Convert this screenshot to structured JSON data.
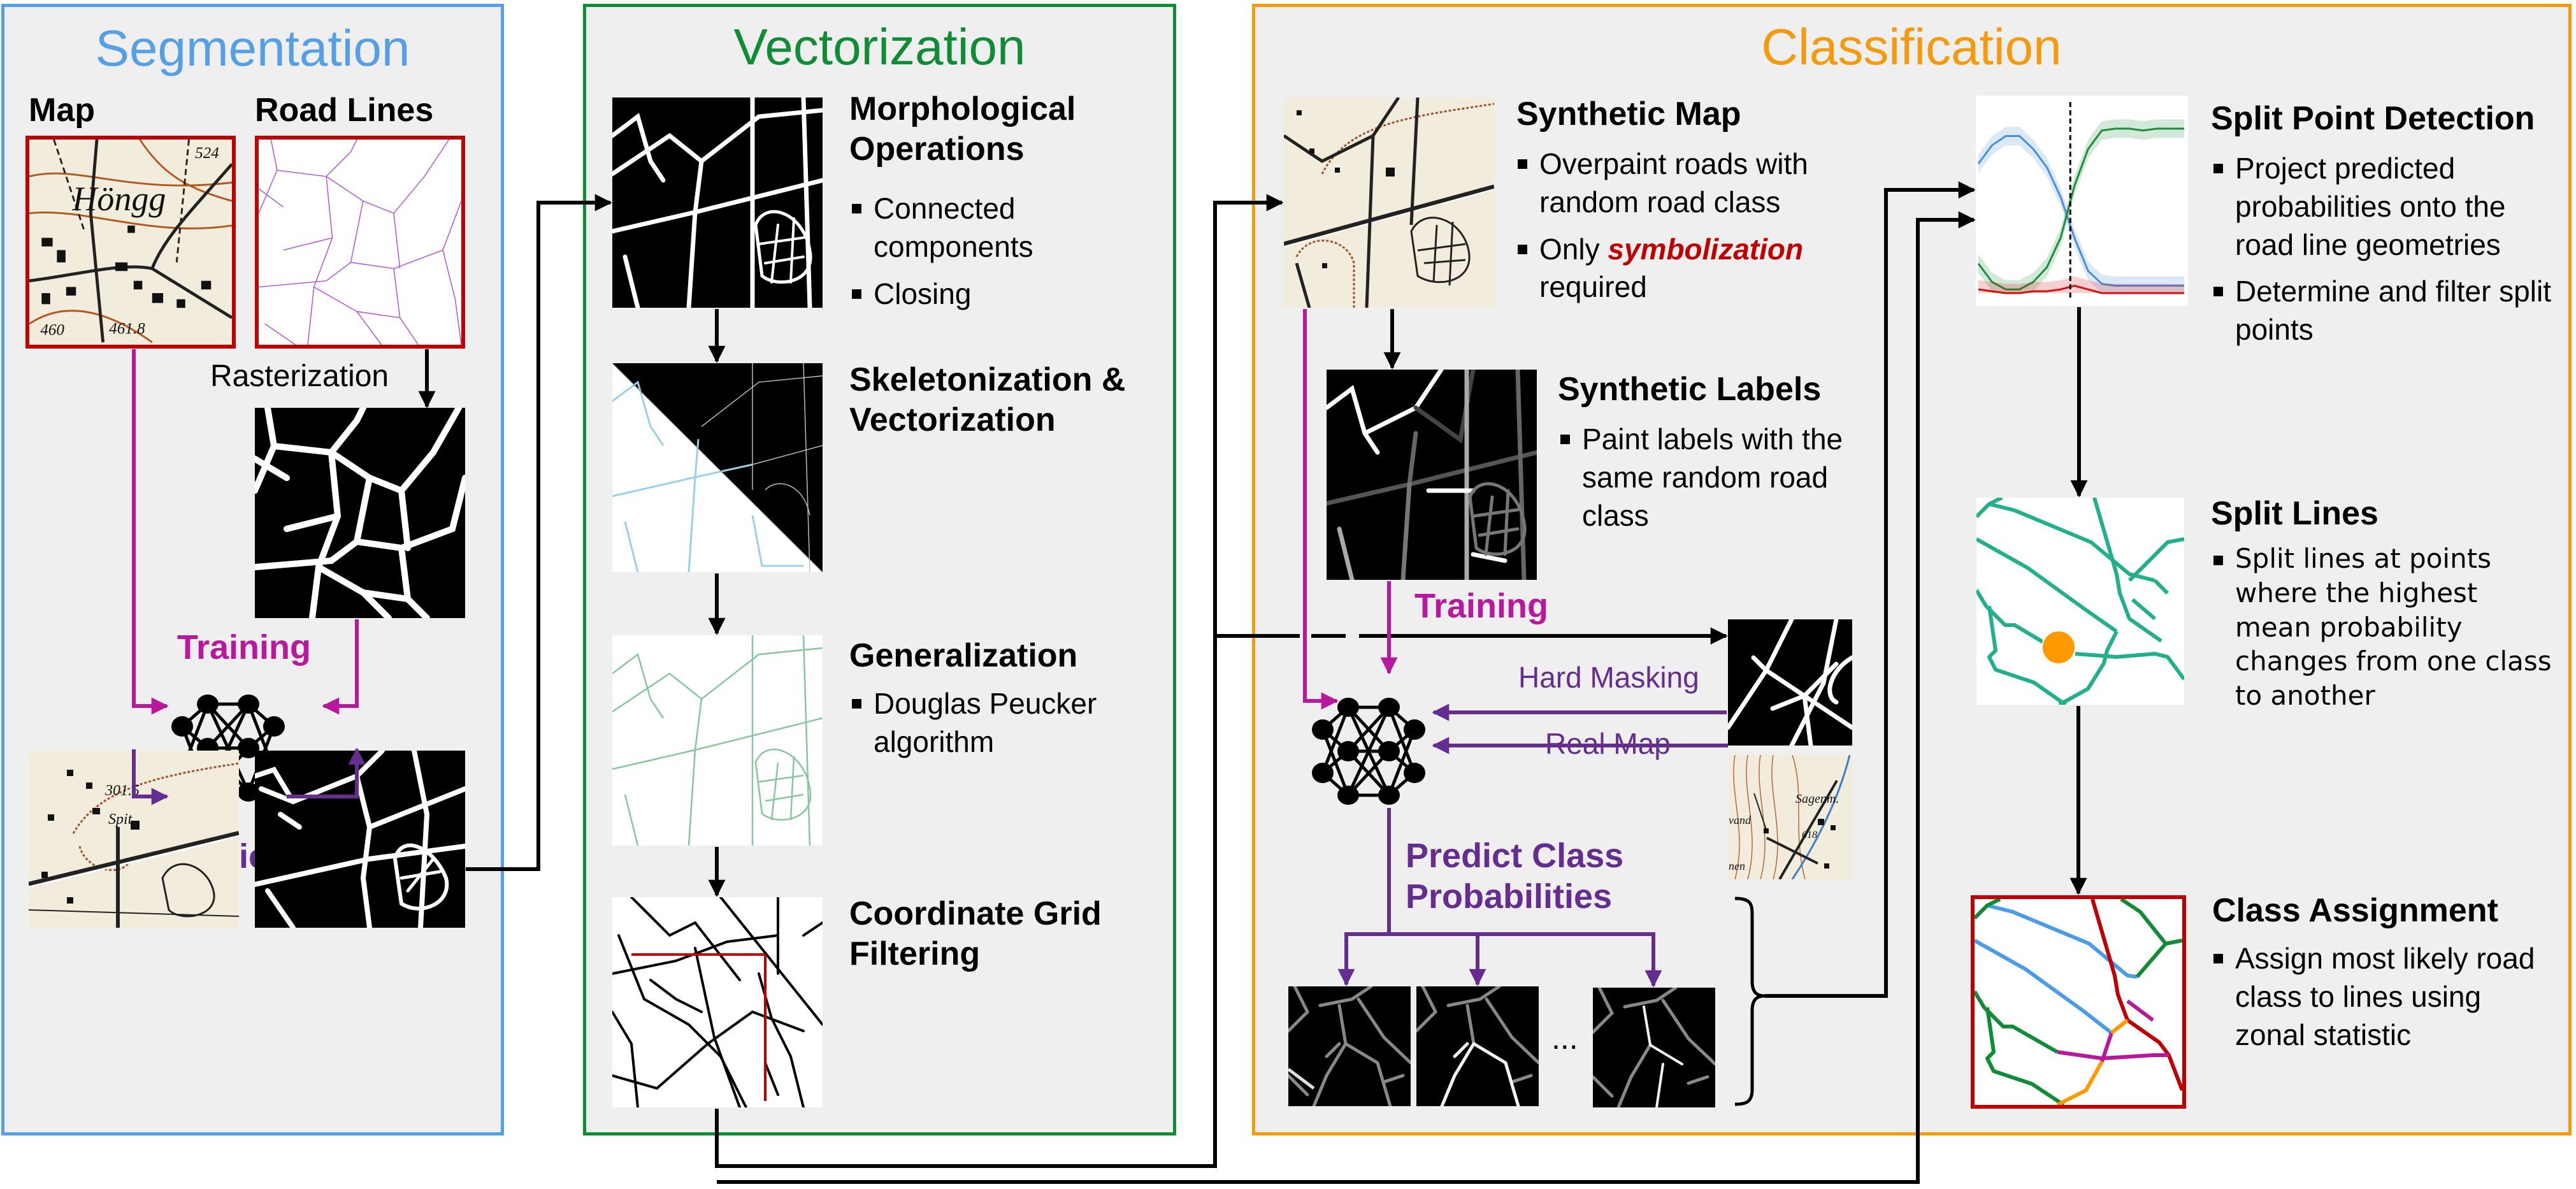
{
  "colors": {
    "segmentation": "#559fe6",
    "vectorization": "#0f8c35",
    "classification": "#f59a0c",
    "training": "#b8189c",
    "prediction": "#662d91",
    "highlight_red": "#c00000",
    "panel_bg": "#efefef"
  },
  "segmentation": {
    "title": "Segmentation",
    "map_label": "Map",
    "road_lines_label": "Road Lines",
    "rasterization_label": "Rasterization",
    "training_label": "Training",
    "prediction_label": "Prediction",
    "map_thumb_text": [
      "Höngg",
      "524",
      "460",
      "461.8"
    ],
    "predict_map_thumb_text": [
      "301.5",
      "Spit"
    ]
  },
  "vectorization": {
    "title": "Vectorization",
    "steps": [
      {
        "title_lines": [
          "Morphological",
          "Operations"
        ],
        "bullets": [
          "Connected components",
          "Closing"
        ]
      },
      {
        "title_lines": [
          "Skeletonization &",
          "Vectorization"
        ],
        "bullets": []
      },
      {
        "title_lines": [
          "Generalization"
        ],
        "bullets": [
          "Douglas Peucker algorithm"
        ]
      },
      {
        "title_lines": [
          "Coordinate Grid",
          "Filtering"
        ],
        "bullets": []
      }
    ]
  },
  "classification": {
    "title": "Classification",
    "synthetic_map": {
      "title": "Synthetic Map",
      "bullet1": "Overpaint roads with random road class",
      "bullet2_prefix": "Only ",
      "bullet2_emphasis": "symbolization",
      "bullet2_suffix": " required"
    },
    "synthetic_labels": {
      "title": "Synthetic Labels",
      "bullets": [
        "Paint labels with the same random road class"
      ]
    },
    "training_label": "Training",
    "hard_masking_label": "Hard Masking",
    "real_map_label": "Real Map",
    "real_map_thumb_text": [
      "Sagenm.",
      "618",
      "vand",
      "nen"
    ],
    "predict_label_lines": [
      "Predict Class",
      "Probabilities"
    ],
    "ellipsis": "...",
    "split_point_detection": {
      "title": "Split Point Detection",
      "bullets": [
        "Project predicted probabilities onto the road line geometries",
        "Determine and filter split points"
      ]
    },
    "split_lines": {
      "title": "Split Lines",
      "bullets": [
        "Split lines at points where the highest mean probability changes from one class to another"
      ]
    },
    "class_assignment": {
      "title": "Class Assignment",
      "bullets": [
        "Assign most likely road class to lines using zonal statistic"
      ]
    }
  },
  "split_point_plot": {
    "x": [
      0,
      1,
      2,
      3,
      4,
      5,
      6,
      7,
      8,
      9,
      10,
      11,
      12,
      13,
      14,
      15
    ],
    "split_index": 6.7,
    "series": [
      {
        "name": "class-blue",
        "color": "#4a90d9",
        "values": [
          0.7,
          0.8,
          0.85,
          0.85,
          0.78,
          0.68,
          0.52,
          0.3,
          0.12,
          0.05,
          0.04,
          0.04,
          0.04,
          0.04,
          0.04,
          0.04
        ]
      },
      {
        "name": "class-green",
        "color": "#1e8c3a",
        "values": [
          0.16,
          0.06,
          0.02,
          0.02,
          0.06,
          0.14,
          0.3,
          0.58,
          0.78,
          0.88,
          0.89,
          0.89,
          0.88,
          0.89,
          0.89,
          0.89
        ]
      },
      {
        "name": "class-red",
        "color": "#d01010",
        "values": [
          0.02,
          0.01,
          0.0,
          0.0,
          0.01,
          0.01,
          0.02,
          0.04,
          0.02,
          0.0,
          0.0,
          0.0,
          0.0,
          0.0,
          0.0,
          0.0
        ]
      }
    ]
  }
}
